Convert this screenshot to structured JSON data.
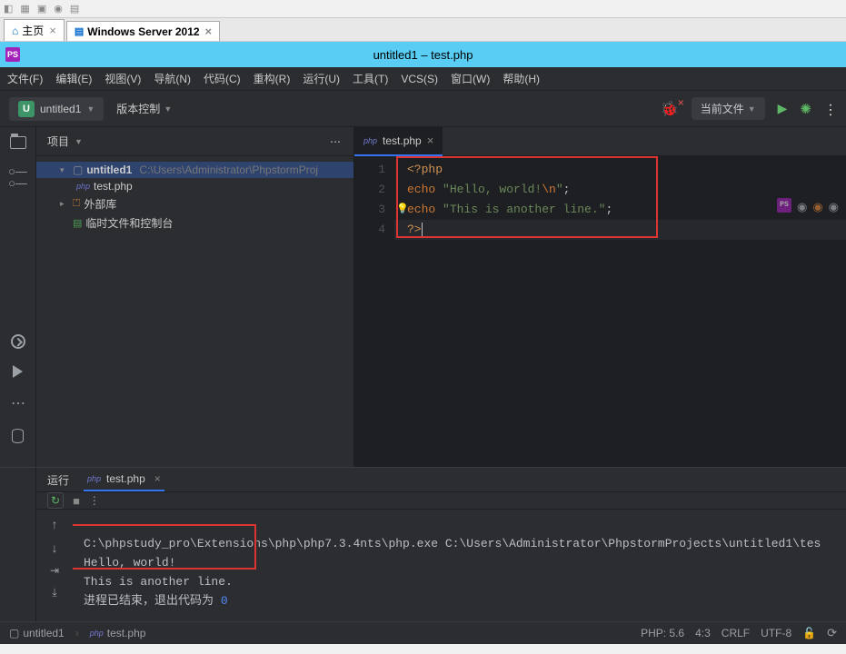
{
  "outer_tabs": {
    "home": "主页",
    "win": "Windows Server 2012"
  },
  "titlebar": {
    "title": "untitled1 – test.php"
  },
  "menu": {
    "file": "文件(F)",
    "edit": "编辑(E)",
    "view": "视图(V)",
    "nav": "导航(N)",
    "code": "代码(C)",
    "refactor": "重构(R)",
    "run": "运行(U)",
    "tools": "工具(T)",
    "vcs": "VCS(S)",
    "window": "窗口(W)",
    "help": "帮助(H)"
  },
  "toolbar": {
    "project": "untitled1",
    "vcs": "版本控制",
    "current_file": "当前文件"
  },
  "project_panel": {
    "title": "项目",
    "root": "untitled1",
    "root_path": "C:\\Users\\Administrator\\PhpstormProj",
    "file": "test.php",
    "libs": "外部库",
    "scratch": "临时文件和控制台"
  },
  "editor": {
    "tab_file": "test.php",
    "lines": {
      "l1a": "<?php",
      "l2a": "echo ",
      "l2b": "\"Hello, world!",
      "l2c": "\\n",
      "l2d": "\"",
      "l2e": ";",
      "l3a": "echo ",
      "l3b": "\"This is another line.\"",
      "l3c": ";",
      "l4a": "?>"
    },
    "line_numbers": [
      "1",
      "2",
      "3",
      "4"
    ]
  },
  "run": {
    "label": "运行",
    "tab": "test.php",
    "cmd": "C:\\phpstudy_pro\\Extensions\\php\\php7.3.4nts\\php.exe C:\\Users\\Administrator\\PhpstormProjects\\untitled1\\tes",
    "out1": "Hello, world!",
    "out2": "This is another line.",
    "exit_prefix": "进程已结束，退出代码为 ",
    "exit_code": "0"
  },
  "status": {
    "bc1": "untitled1",
    "bc2": "test.php",
    "php": "PHP: 5.6",
    "pos": "4:3",
    "crlf": "CRLF",
    "enc": "UTF-8"
  }
}
